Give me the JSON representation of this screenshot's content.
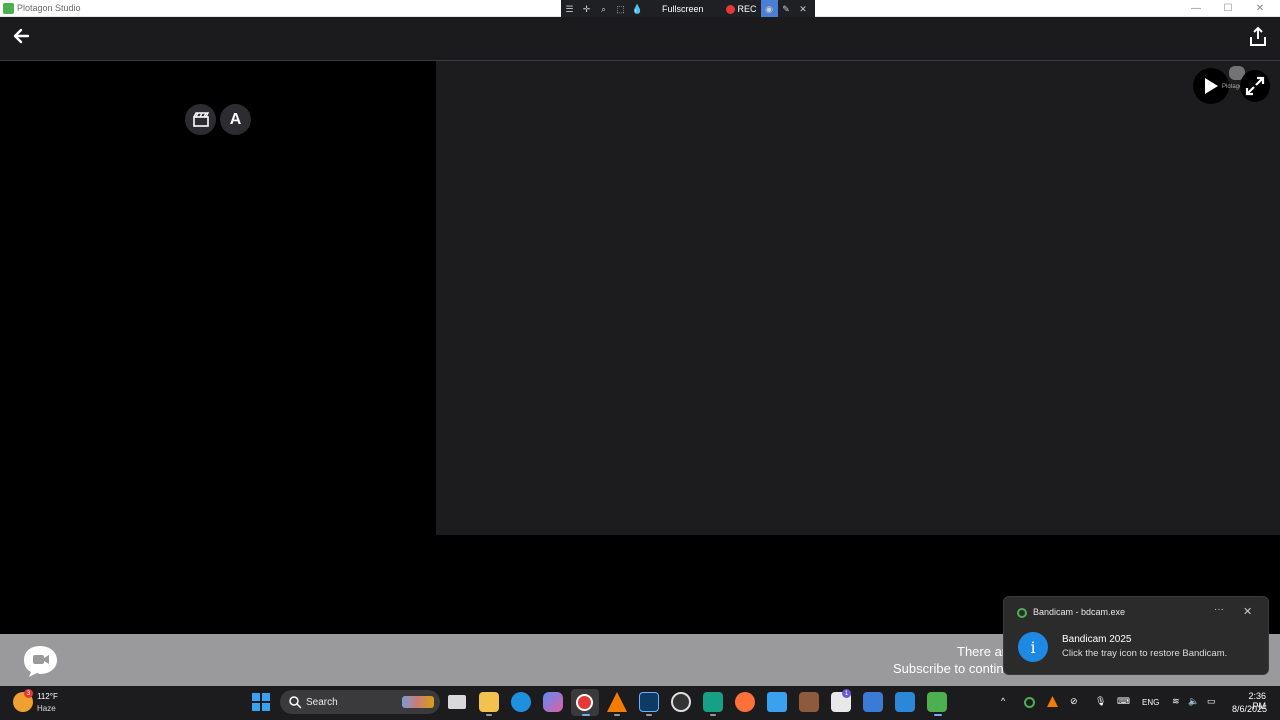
{
  "window": {
    "title": "Plotagon Studio",
    "controls": {
      "minimize": "—",
      "maximize": "☐",
      "close": "✕"
    }
  },
  "bandicam_bar": {
    "fullscreen_label": "Fullscreen",
    "rec_label": "REC"
  },
  "header": {
    "back_icon": "arrow-left-icon",
    "share_icon": "share-icon"
  },
  "left_panel": {
    "buttons": [
      "clapperboard-icon",
      "text-A-icon"
    ],
    "text_button_glyph": "A"
  },
  "stage": {
    "controls": [
      "play-icon",
      "fullscreen-icon"
    ],
    "watermark_text": "Plotagon studio"
  },
  "promo": {
    "line1": "There ar",
    "line2": "Subscribe to continu"
  },
  "notification": {
    "app": "Bandicam - bdcam.exe",
    "more": "···",
    "title": "Bandicam 2025",
    "body": "Click the tray icon to restore Bandicam.",
    "info_glyph": "i"
  },
  "taskbar": {
    "weather": {
      "temp": "112°F",
      "desc": "Haze",
      "badge": "3"
    },
    "search_placeholder": "Search",
    "language": "ENG",
    "time": "2:36 PM",
    "date": "8/6/2025",
    "store_badge": "1"
  },
  "colors": {
    "accent": "#1e88e5",
    "rec": "#e53935",
    "plotagon": "#4caf50"
  }
}
